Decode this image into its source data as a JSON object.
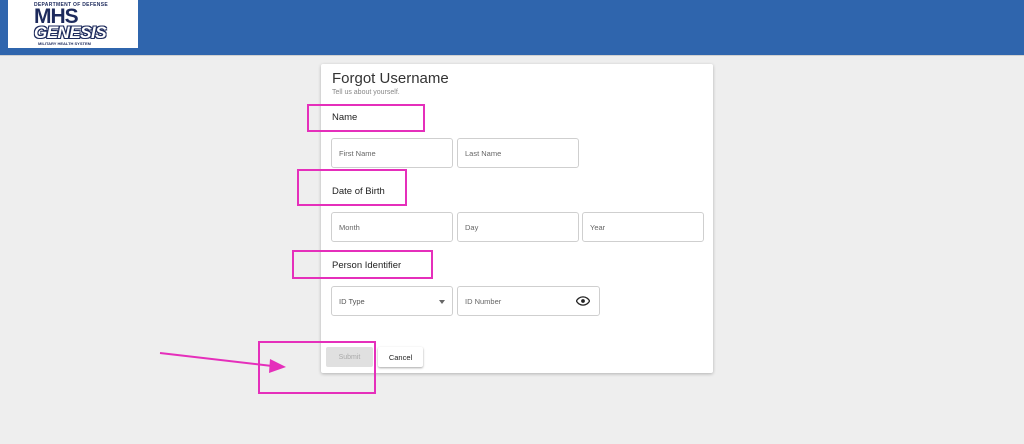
{
  "header": {
    "logo": {
      "top_text": "DEPARTMENT OF DEFENSE",
      "mhs": "MHS",
      "genesis": "GENESIS",
      "sub_text": "MILITARY HEALTH SYSTEM"
    },
    "bar_color": "#2f65ad"
  },
  "form": {
    "title": "Forgot Username",
    "subtitle": "Tell us about yourself.",
    "name_section": {
      "label": "Name",
      "first_name_placeholder": "First Name",
      "last_name_placeholder": "Last Name"
    },
    "dob_section": {
      "label": "Date of Birth",
      "month_placeholder": "Month",
      "day_placeholder": "Day",
      "year_placeholder": "Year"
    },
    "id_section": {
      "label": "Person Identifier",
      "id_type_value": "ID Type",
      "id_number_placeholder": "ID Number",
      "visibility_icon": "eye-icon"
    },
    "actions": {
      "submit_label": "Submit",
      "cancel_label": "Cancel"
    }
  },
  "annotations": {
    "highlight_color": "#e52fbb"
  }
}
